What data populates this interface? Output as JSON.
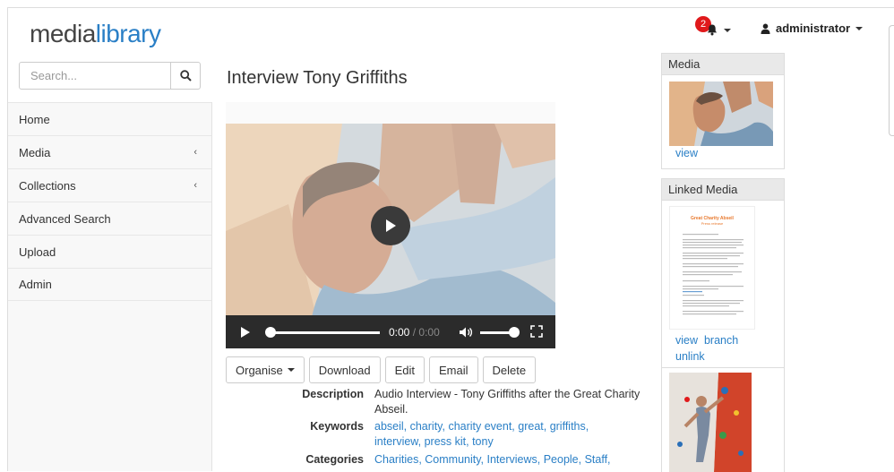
{
  "logo": {
    "part1": "media",
    "part2": "library"
  },
  "search": {
    "placeholder": "Search..."
  },
  "nav": {
    "items": [
      {
        "label": "Home",
        "has_submenu": false
      },
      {
        "label": "Media",
        "has_submenu": true
      },
      {
        "label": "Collections",
        "has_submenu": true
      },
      {
        "label": "Advanced Search",
        "has_submenu": false
      },
      {
        "label": "Upload",
        "has_submenu": false
      },
      {
        "label": "Admin",
        "has_submenu": false
      }
    ],
    "chevron": "‹"
  },
  "topbar": {
    "notification_count": "2",
    "user": "administrator"
  },
  "page": {
    "title": "Interview Tony Griffiths"
  },
  "player": {
    "time_current": "0:00",
    "time_separator": "/",
    "time_total": "0:00"
  },
  "actions": {
    "organise": "Organise",
    "download": "Download",
    "edit": "Edit",
    "email": "Email",
    "delete": "Delete"
  },
  "details": {
    "description_label": "Description",
    "description": "Audio Interview - Tony Griffiths after the Great Charity Abseil.",
    "keywords_label": "Keywords",
    "keywords": "abseil, charity, charity event, great, griffiths, interview, press kit, tony",
    "categories_label": "Categories",
    "categories": "Charities, Community, Interviews, People, Staff,"
  },
  "media_panel": {
    "title": "Media",
    "view": "view"
  },
  "linked_panel": {
    "title": "Linked Media",
    "doc_title": "Great Charity Abseil",
    "doc_subtitle": "Press release",
    "view": "view",
    "branch": "branch",
    "unlink": "unlink"
  },
  "colors": {
    "accent": "#2a7fc6",
    "badge": "#e0191b",
    "doc_heading": "#e8792e"
  },
  "icons": [
    "search-icon",
    "bell-icon",
    "user-icon",
    "chevron-left-icon",
    "play-icon",
    "volume-icon",
    "fullscreen-icon",
    "caret-down-icon"
  ]
}
